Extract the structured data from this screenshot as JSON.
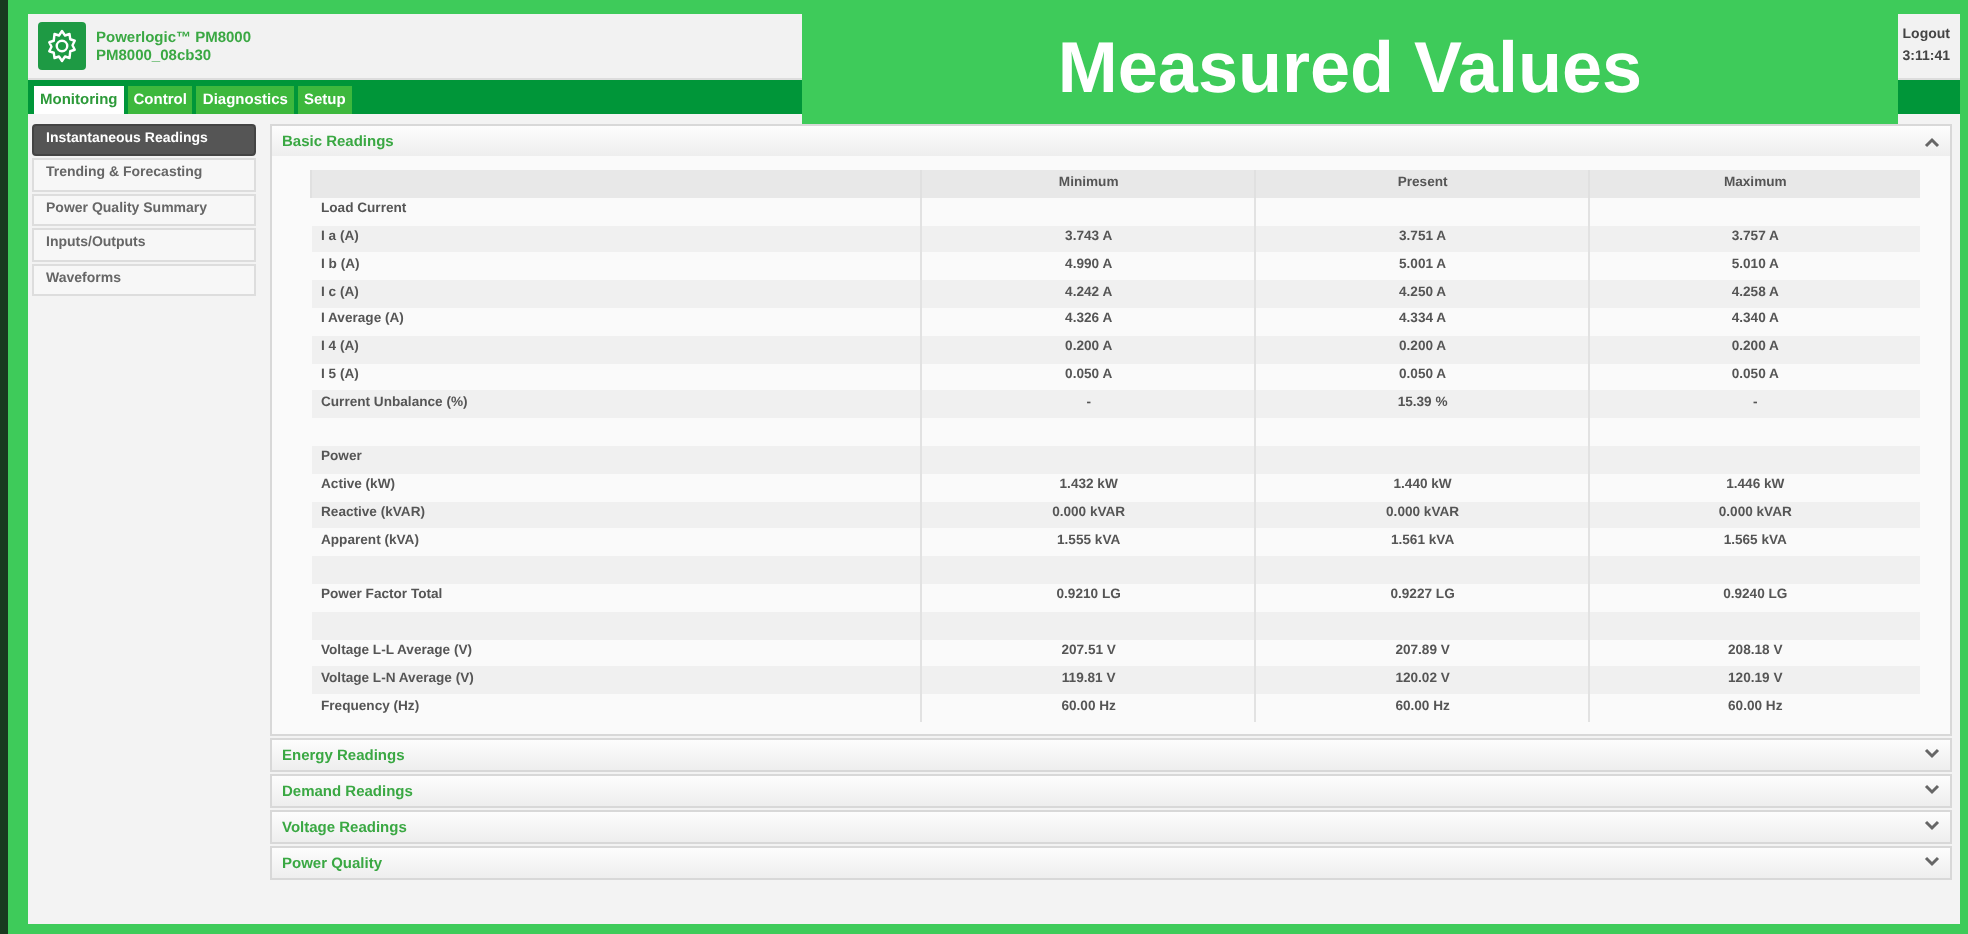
{
  "overlay_banner": {
    "title": "Measured Values"
  },
  "header": {
    "product": "Powerlogic™ PM8000",
    "device": "PM8000_08cb30",
    "logout": "Logout",
    "time": "3:11:41"
  },
  "tabs": [
    {
      "label": "Monitoring",
      "selected": true
    },
    {
      "label": "Control",
      "selected": false
    },
    {
      "label": "Diagnostics",
      "selected": false
    },
    {
      "label": "Setup",
      "selected": false
    }
  ],
  "sidebar": {
    "items": [
      {
        "label": "Instantaneous Readings",
        "selected": true
      },
      {
        "label": "Trending & Forecasting",
        "selected": false
      },
      {
        "label": "Power Quality Summary",
        "selected": false
      },
      {
        "label": "Inputs/Outputs",
        "selected": false
      },
      {
        "label": "Waveforms",
        "selected": false
      }
    ]
  },
  "sections": [
    {
      "title": "Basic Readings",
      "expanded": true,
      "table": {
        "columns": [
          "Minimum",
          "Present",
          "Maximum"
        ],
        "rows": [
          {
            "kind": "section",
            "label": "Load Current"
          },
          {
            "kind": "data",
            "label": "I a (A)",
            "values": [
              "3.743 A",
              "3.751 A",
              "3.757 A"
            ]
          },
          {
            "kind": "data",
            "label": "I b (A)",
            "values": [
              "4.990 A",
              "5.001 A",
              "5.010 A"
            ]
          },
          {
            "kind": "data",
            "label": "I c (A)",
            "values": [
              "4.242 A",
              "4.250 A",
              "4.258 A"
            ]
          },
          {
            "kind": "data",
            "label": "I Average (A)",
            "values": [
              "4.326 A",
              "4.334 A",
              "4.340 A"
            ]
          },
          {
            "kind": "data",
            "label": "I 4 (A)",
            "values": [
              "0.200 A",
              "0.200 A",
              "0.200 A"
            ]
          },
          {
            "kind": "data",
            "label": "I 5 (A)",
            "values": [
              "0.050 A",
              "0.050 A",
              "0.050 A"
            ]
          },
          {
            "kind": "data",
            "label": "Current Unbalance (%)",
            "values": [
              "-",
              "15.39 %",
              "-"
            ]
          },
          {
            "kind": "spacer"
          },
          {
            "kind": "section",
            "label": "Power"
          },
          {
            "kind": "data",
            "label": "Active (kW)",
            "values": [
              "1.432 kW",
              "1.440 kW",
              "1.446 kW"
            ]
          },
          {
            "kind": "data",
            "label": "Reactive (kVAR)",
            "values": [
              "0.000 kVAR",
              "0.000 kVAR",
              "0.000 kVAR"
            ]
          },
          {
            "kind": "data",
            "label": "Apparent (kVA)",
            "values": [
              "1.555 kVA",
              "1.561 kVA",
              "1.565 kVA"
            ]
          },
          {
            "kind": "spacer"
          },
          {
            "kind": "data",
            "label": "Power Factor Total",
            "values": [
              "0.9210 LG",
              "0.9227 LG",
              "0.9240 LG"
            ]
          },
          {
            "kind": "spacer"
          },
          {
            "kind": "data",
            "label": "Voltage L-L Average (V)",
            "values": [
              "207.51 V",
              "207.89 V",
              "208.18 V"
            ]
          },
          {
            "kind": "data",
            "label": "Voltage L-N Average (V)",
            "values": [
              "119.81 V",
              "120.02 V",
              "120.19 V"
            ]
          },
          {
            "kind": "data",
            "label": "Frequency (Hz)",
            "values": [
              "60.00 Hz",
              "60.00 Hz",
              "60.00 Hz"
            ]
          }
        ]
      }
    },
    {
      "title": "Energy Readings",
      "expanded": false
    },
    {
      "title": "Demand Readings",
      "expanded": false
    },
    {
      "title": "Voltage Readings",
      "expanded": false
    },
    {
      "title": "Power Quality",
      "expanded": false
    }
  ]
}
